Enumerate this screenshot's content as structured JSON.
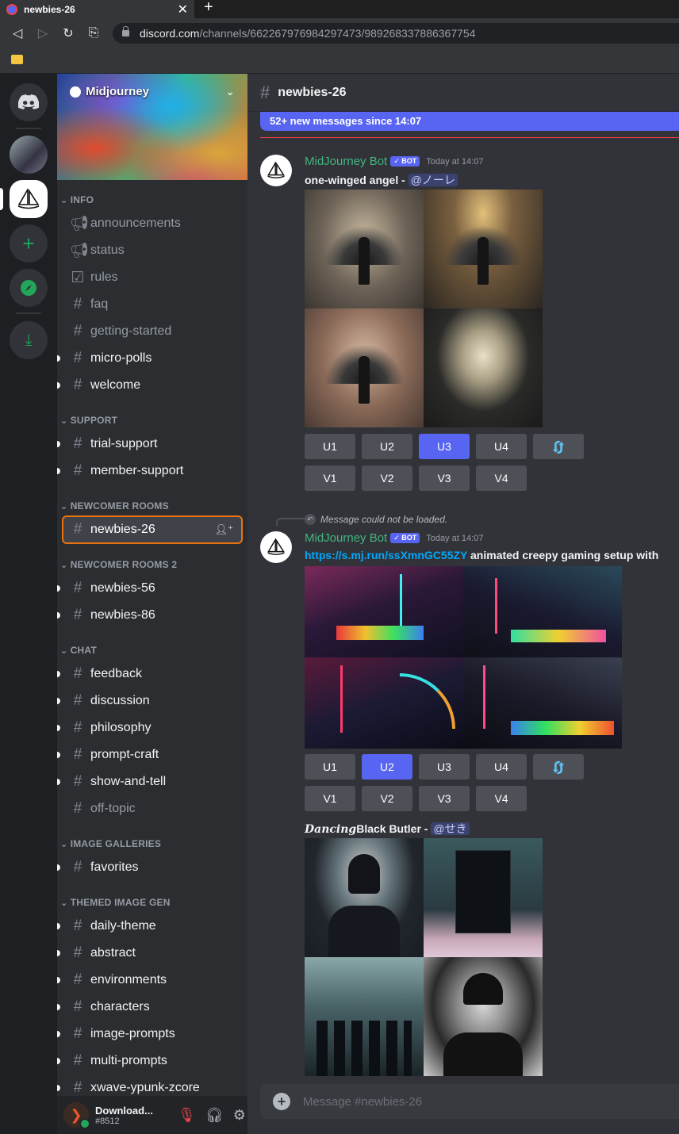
{
  "browser": {
    "tab_title": "newbies-26",
    "url_host": "discord.com",
    "url_path": "/channels/662267976984297473/989268337886367754"
  },
  "server": {
    "name": "Midjourney"
  },
  "sidebar": {
    "categories": [
      {
        "name": "INFO",
        "channels": [
          {
            "name": "announcements",
            "icon": "megaphone-icon"
          },
          {
            "name": "status",
            "icon": "megaphone-icon"
          },
          {
            "name": "rules",
            "icon": "checkbox-icon"
          },
          {
            "name": "faq",
            "icon": "hash-icon"
          },
          {
            "name": "getting-started",
            "icon": "hash-icon"
          },
          {
            "name": "micro-polls",
            "icon": "hash-icon"
          },
          {
            "name": "welcome",
            "icon": "hash-lock-icon"
          }
        ]
      },
      {
        "name": "SUPPORT",
        "channels": [
          {
            "name": "trial-support"
          },
          {
            "name": "member-support"
          }
        ]
      },
      {
        "name": "NEWCOMER ROOMS",
        "channels": [
          {
            "name": "newbies-26"
          }
        ]
      },
      {
        "name": "NEWCOMER ROOMS 2",
        "channels": [
          {
            "name": "newbies-56"
          },
          {
            "name": "newbies-86"
          }
        ]
      },
      {
        "name": "CHAT",
        "channels": [
          {
            "name": "feedback"
          },
          {
            "name": "discussion"
          },
          {
            "name": "philosophy"
          },
          {
            "name": "prompt-craft"
          },
          {
            "name": "show-and-tell"
          },
          {
            "name": "off-topic"
          }
        ]
      },
      {
        "name": "IMAGE GALLERIES",
        "channels": [
          {
            "name": "favorites"
          }
        ]
      },
      {
        "name": "THEMED IMAGE GEN",
        "channels": [
          {
            "name": "daily-theme"
          },
          {
            "name": "abstract"
          },
          {
            "name": "environments"
          },
          {
            "name": "characters"
          },
          {
            "name": "image-prompts"
          },
          {
            "name": "multi-prompts"
          },
          {
            "name": "xwave-ypunk-zcore"
          }
        ]
      }
    ]
  },
  "user": {
    "name": "Download...",
    "tag": "#8512"
  },
  "channel": {
    "name": "newbies-26",
    "new_messages": "52+ new messages since 14:07",
    "composer_placeholder": "Message #newbies-26"
  },
  "messages": [
    {
      "author": "MidJourney Bot",
      "badge": "✓ BOT",
      "time": "Today at 14:07",
      "prompt": "one-winged angel",
      "separator": " - ",
      "mention": "@ノーレ",
      "buttons_u": [
        "U1",
        "U2",
        "U3",
        "U4"
      ],
      "buttons_v": [
        "V1",
        "V2",
        "V3",
        "V4"
      ]
    },
    {
      "reply": "Message could not be loaded.",
      "author": "MidJourney Bot",
      "badge": "✓ BOT",
      "time": "Today at 14:07",
      "link": "https://s.mj.run/ssXmnGC55ZY",
      "prompt": " animated creepy gaming setup with",
      "buttons_u": [
        "U1",
        "U2",
        "U3",
        "U4"
      ],
      "buttons_v": [
        "V1",
        "V2",
        "V3",
        "V4"
      ]
    },
    {
      "prompt_fancy": "Dancing",
      "prompt": "Black Butler",
      "separator": " - ",
      "mention": "@せき"
    }
  ]
}
